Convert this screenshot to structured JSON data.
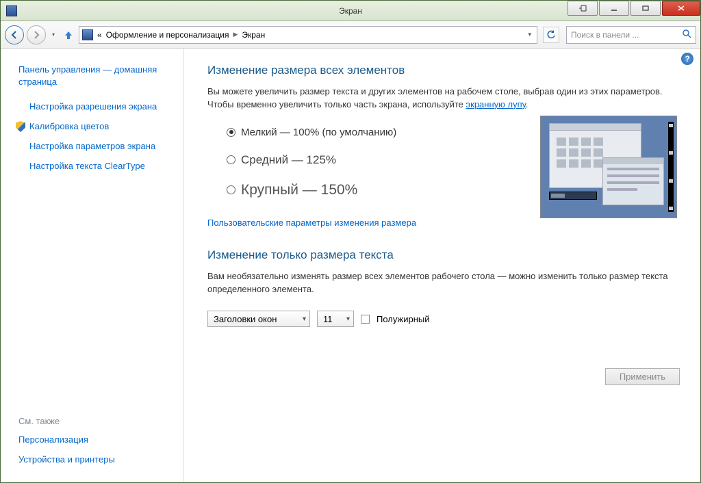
{
  "window": {
    "title": "Экран"
  },
  "breadcrumb": {
    "part1": "Оформление и персонализация",
    "part2": "Экран"
  },
  "search": {
    "placeholder": "Поиск в панели ..."
  },
  "sidebar": {
    "home": "Панель управления — домашняя страница",
    "links": [
      "Настройка разрешения экрана",
      "Калибровка цветов",
      "Настройка параметров экрана",
      "Настройка текста ClearType"
    ],
    "see_also_header": "См. также",
    "see_also": [
      "Персонализация",
      "Устройства и принтеры"
    ]
  },
  "main": {
    "h1": "Изменение размера всех элементов",
    "para1a": "Вы можете увеличить размер текста и других элементов на рабочем столе, выбрав один из этих параметров. Чтобы временно увеличить только часть экрана, используйте ",
    "magnifier_link": "экранную лупу",
    "radios": {
      "small": "Мелкий — 100% (по умолчанию)",
      "medium": "Средний — 125%",
      "large": "Крупный — 150%"
    },
    "custom_link": "Пользовательские параметры изменения размера",
    "h2": "Изменение только размера текста",
    "para2": "Вам необязательно изменять размер всех элементов рабочего стола — можно изменить только размер текста определенного элемента.",
    "element_select": "Заголовки окон",
    "size_select": "11",
    "bold_label": "Полужирный",
    "apply": "Применить"
  }
}
